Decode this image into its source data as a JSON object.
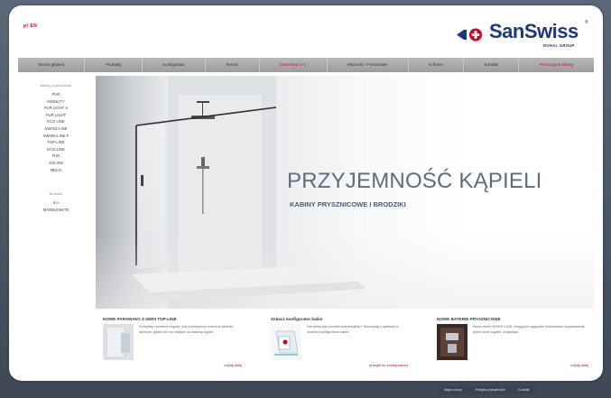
{
  "header": {
    "lang": "pl EN",
    "logo": {
      "name": "SanSwiss",
      "reg": "®",
      "sub": "RONAL GROUP"
    }
  },
  "nav": {
    "items": [
      {
        "label": "Strona główna",
        "red": false
      },
      {
        "label": "Produkty",
        "red": false
      },
      {
        "label": "Konfigurator",
        "red": false
      },
      {
        "label": "Pomoc",
        "red": false
      },
      {
        "label": "Download 2+1",
        "red": true
      },
      {
        "label": "Ważność / Pomiarowe",
        "red": false
      },
      {
        "label": "O firmie",
        "red": false
      },
      {
        "label": "Kontakt",
        "red": false
      },
      {
        "label": "Promocyjne kabiny",
        "red": true
      }
    ]
  },
  "sidebar": {
    "head1": "kabiny prysznicowe",
    "items1": [
      "PUR",
      "MOBILITY",
      "PUR LIGHT S",
      "PUR LIGHT",
      "ECO LINE",
      "SWING-LINE",
      "SWING-LINE F",
      "TOP-LINE",
      "ECO-LINE",
      "FUN",
      "SOLINO",
      "MELIA"
    ],
    "head2": "Brodziki",
    "items2": [
      "ILA",
      "MARBLEMATE"
    ]
  },
  "hero": {
    "title": "PRZYJEMNOŚĆ KĄPIELI",
    "subtitle": "KABINY PRYSZNICOWE I BRODZIKI"
  },
  "promos": [
    {
      "title": "NOWE PARAWANY Z SERII TOP-LINE",
      "text": "Komplety i komfortu kąpieli, jest przestronny rezerw w wielkiej łazience; gdzie nie ma miejsca na zasłonę kąpiel.",
      "more": "czytaj dalej"
    },
    {
      "title": "Zobacz konfigurator kabin",
      "text": "Nie wiesz jaki produkt potrzebujesz? Skorzystaj z aplikacji w okienku konfiguratora kabin.",
      "more": "przejdź do konfiguratora"
    },
    {
      "title": "NOWE BATERIE PRYSZNICOWE",
      "text": "Nowe drzwi SWING-LINE, mogących wygodne kontrolować dopasowanie przez serie kąpieli i podziwiać.",
      "more": "czytaj dalej"
    }
  ],
  "footer": {
    "links": [
      "Mapa strony",
      "Polityka prywatności",
      "Kontakt"
    ]
  }
}
